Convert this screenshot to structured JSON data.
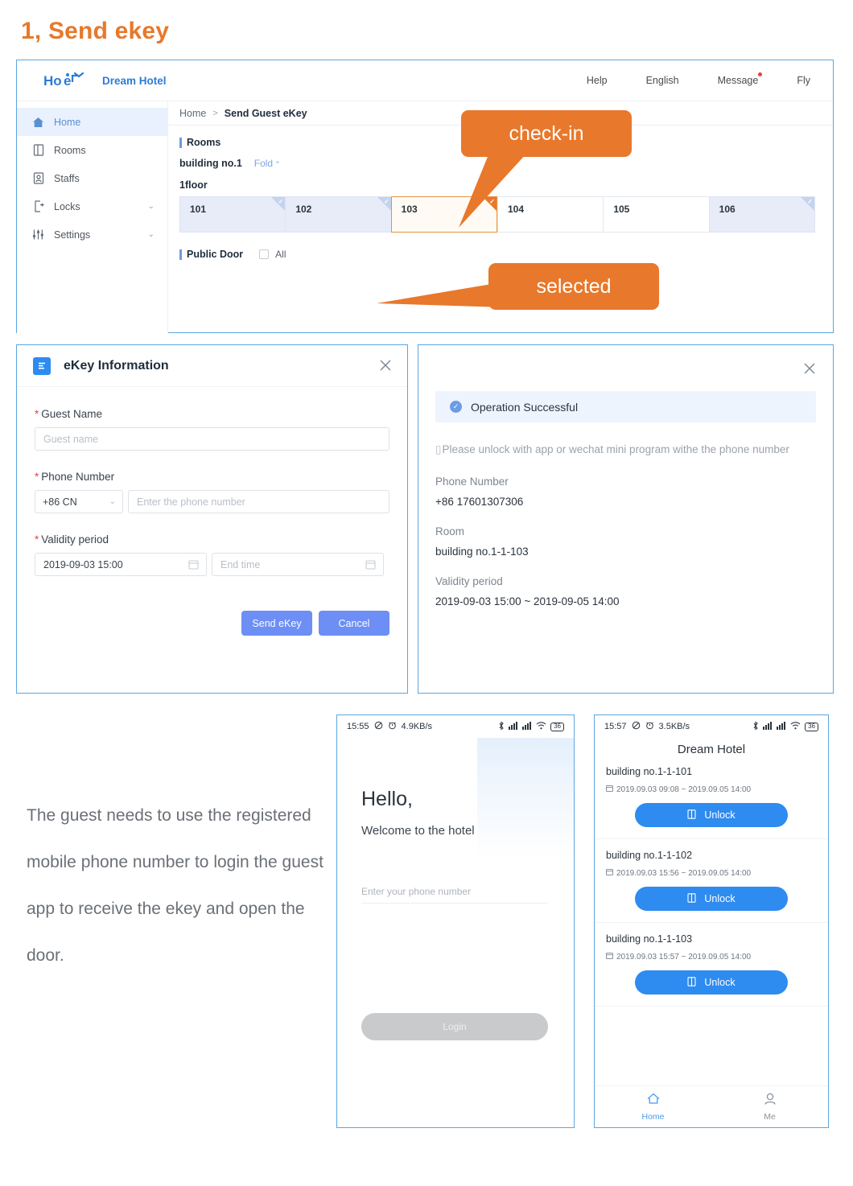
{
  "section": {
    "title": "1, Send ekey"
  },
  "webapp": {
    "brand": "Dream Hotel",
    "logo_text": "Hotel",
    "nav": [
      {
        "label": "Help",
        "name": "help"
      },
      {
        "label": "English",
        "name": "english"
      },
      {
        "label": "Message",
        "name": "message",
        "badge": true
      },
      {
        "label": "Fly",
        "name": "fly"
      }
    ],
    "sidebar": [
      {
        "label": "Home",
        "icon": "home-icon",
        "active": true,
        "caret": false
      },
      {
        "label": "Rooms",
        "icon": "door-icon",
        "active": false,
        "caret": false
      },
      {
        "label": "Staffs",
        "icon": "staff-icon",
        "active": false,
        "caret": false
      },
      {
        "label": "Locks",
        "icon": "lock-icon",
        "active": false,
        "caret": true
      },
      {
        "label": "Settings",
        "icon": "sliders-icon",
        "active": false,
        "caret": true
      }
    ],
    "breadcrumb": {
      "home": "Home",
      "separator": ">",
      "current": "Send Guest eKey"
    },
    "rooms_title": "Rooms",
    "building": "building no.1",
    "fold_label": "Fold",
    "floor": "1floor",
    "rooms": [
      {
        "number": "101",
        "state": "occupied"
      },
      {
        "number": "102",
        "state": "occupied"
      },
      {
        "number": "103",
        "state": "selected"
      },
      {
        "number": "104",
        "state": "free"
      },
      {
        "number": "105",
        "state": "free"
      },
      {
        "number": "106",
        "state": "occupied"
      }
    ],
    "public_door_title": "Public Door",
    "public_door_all": "All"
  },
  "callouts": {
    "checkin": "check-in",
    "selected": "selected",
    "color": "#E8782B"
  },
  "ekey_dialog": {
    "title": "eKey Information",
    "guest_name_label": "Guest Name",
    "guest_name_placeholder": "Guest name",
    "phone_label": "Phone Number",
    "country_code": "+86 CN",
    "phone_placeholder": "Enter the phone number",
    "validity_label": "Validity period",
    "start_time": "2019-09-03 15:00",
    "end_time_placeholder": "End time",
    "send_label": "Send eKey",
    "cancel_label": "Cancel",
    "required_mark": "*"
  },
  "success_panel": {
    "alert": "Operation Successful",
    "hint": "Please unlock with app or wechat mini program withe the phone number",
    "phone_label": "Phone Number",
    "phone_value": "+86 17601307306",
    "room_label": "Room",
    "room_value": "building no.1-1-103",
    "validity_label": "Validity period",
    "validity_value": "2019-09-03 15:00  ~  2019-09-05 14:00"
  },
  "description": "The guest needs to use the registered mobile phone number to login the guest app to receive the ekey and open the door.",
  "phone_login": {
    "status": {
      "time": "15:55",
      "net": "4.9KB/s",
      "battery": "36"
    },
    "hello": "Hello,",
    "welcome": "Welcome to the hotel",
    "phone_placeholder": "Enter your phone number",
    "login_label": "Login"
  },
  "phone_keys": {
    "status": {
      "time": "15:57",
      "net": "3.5KB/s",
      "battery": "36"
    },
    "title": "Dream Hotel",
    "items": [
      {
        "room": "building no.1-1-101",
        "time": "2019.09.03 09:08 ~ 2019.09.05 14:00",
        "unlock": "Unlock"
      },
      {
        "room": "building no.1-1-102",
        "time": "2019.09.03 15:56 ~ 2019.09.05 14:00",
        "unlock": "Unlock"
      },
      {
        "room": "building no.1-1-103",
        "time": "2019.09.03 15:57 ~ 2019.09.05 14:00",
        "unlock": "Unlock"
      }
    ],
    "tabs": [
      {
        "label": "Home",
        "icon": "home-icon",
        "active": true
      },
      {
        "label": "Me",
        "icon": "person-icon",
        "active": false
      }
    ]
  }
}
